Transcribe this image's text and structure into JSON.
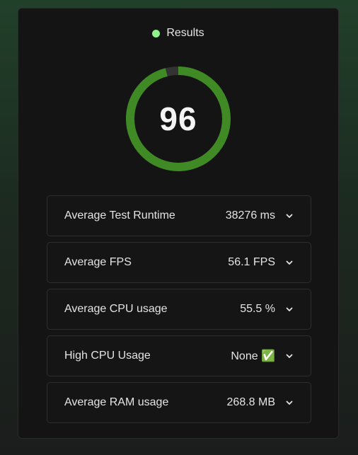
{
  "results": {
    "title": "Results",
    "status_color": "#8ff28a",
    "score": "96",
    "score_fraction": 0.96,
    "gauge_color": "#3f8a24",
    "gauge_track_color": "#333333"
  },
  "metrics": [
    {
      "label": "Average Test Runtime",
      "value": "38276 ms",
      "icon": "chevron-down-icon"
    },
    {
      "label": "Average FPS",
      "value": "56.1 FPS",
      "icon": "chevron-down-icon"
    },
    {
      "label": "Average CPU usage",
      "value": "55.5 %",
      "icon": "chevron-down-icon"
    },
    {
      "label": "High CPU Usage",
      "value": "None ✅",
      "icon": "chevron-down-icon"
    },
    {
      "label": "Average RAM usage",
      "value": "268.8 MB",
      "icon": "chevron-down-icon"
    }
  ]
}
